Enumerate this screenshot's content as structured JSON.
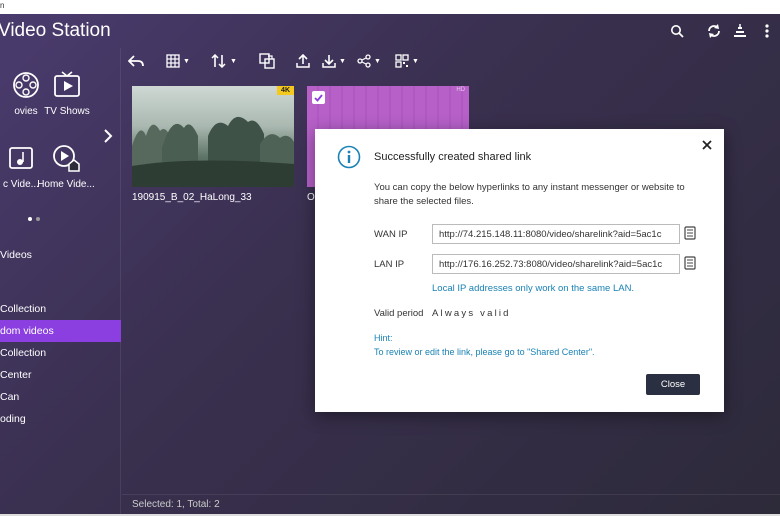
{
  "os": {
    "corner_text": "n"
  },
  "app": {
    "title": "Video Station"
  },
  "header": {
    "icons": [
      "search-icon",
      "refresh-icon",
      "background-tasks-icon",
      "more-icon"
    ]
  },
  "sidebar": {
    "categories": [
      {
        "label": "ovies",
        "icon": "film-reel-icon"
      },
      {
        "label": "TV Shows",
        "icon": "tv-icon"
      },
      {
        "label": "c Vide...",
        "icon": "music-video-icon"
      },
      {
        "label": "Home Vide...",
        "icon": "home-video-icon"
      }
    ],
    "nav": [
      {
        "label": " Videos",
        "active": false
      },
      {
        "label": "Collection",
        "active": false
      },
      {
        "label": "dom videos",
        "active": true
      },
      {
        "label": "Collection",
        "active": false
      },
      {
        "label": " Center",
        "active": false
      },
      {
        "label": "Can",
        "active": false
      },
      {
        "label": "oding",
        "active": false
      }
    ]
  },
  "toolbar": {
    "buttons": [
      "back-icon",
      "grid-view-icon",
      "sort-icon",
      "convert-icon",
      "upload-icon",
      "download-icon",
      "share-icon",
      "qr-code-icon"
    ]
  },
  "videos": [
    {
      "name": "190915_B_02_HaLong_33",
      "badge": "4K",
      "selected": false
    },
    {
      "name": "O",
      "badge": "HD",
      "selected": true
    }
  ],
  "status": {
    "text": "Selected: 1, Total: 2"
  },
  "dialog": {
    "title": "Successfully created shared link",
    "description": "You can copy the below hyperlinks to any instant messenger or website to share the selected files.",
    "wan_label": "WAN IP",
    "wan_value": "http://74.215.148.11:8080/video/sharelink?aid=5ac1c",
    "lan_label": "LAN IP",
    "lan_value": "http://176.16.252.73:8080/video/sharelink?aid=5ac1c",
    "lan_note": "Local IP addresses only work on the same LAN.",
    "valid_label": "Valid period",
    "valid_value": "Always valid",
    "hint_title": "Hint:",
    "hint_text": "To review or edit the link, please go to \"Shared Center\".",
    "close_label": "Close"
  },
  "colors": {
    "accent": "#8b3fe0",
    "link": "#1a82b5",
    "badge_4k": "#f4c81c",
    "close_button": "#2a3042"
  }
}
